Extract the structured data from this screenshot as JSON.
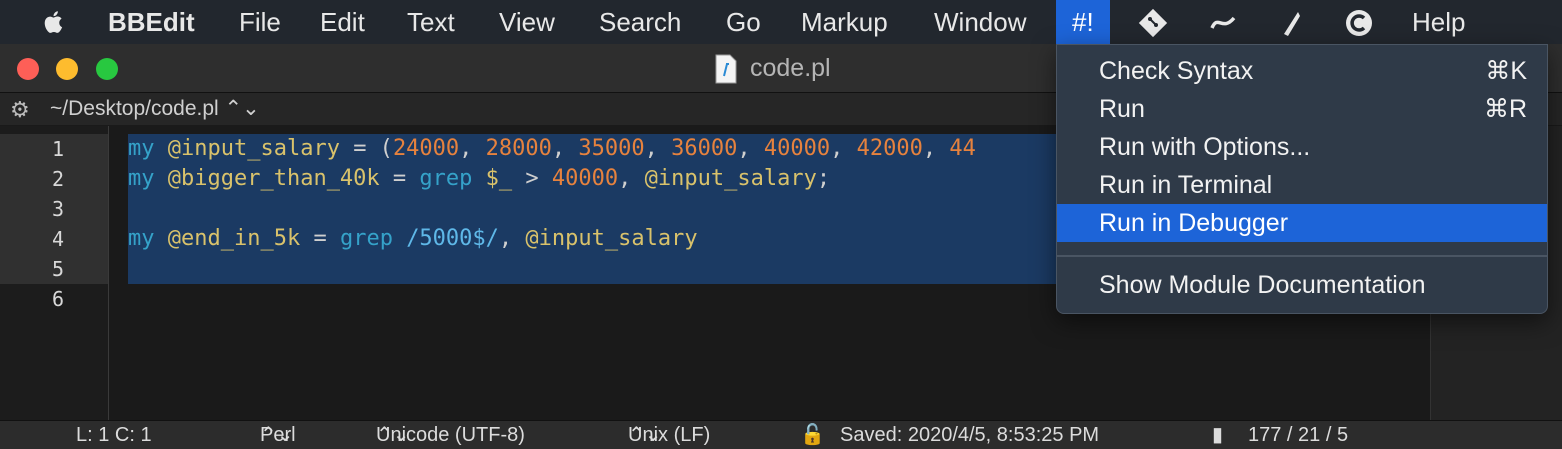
{
  "menubar": {
    "app": "BBEdit",
    "items": [
      "File",
      "Edit",
      "Text",
      "View",
      "Search",
      "Go",
      "Markup",
      "Window",
      "#!",
      "Help"
    ]
  },
  "window": {
    "title": "code.pl",
    "path": "~/Desktop/code.pl"
  },
  "editor": {
    "line_numbers": [
      "1",
      "2",
      "3",
      "4",
      "5",
      "6"
    ]
  },
  "menu": {
    "items": [
      {
        "label": "Check Syntax",
        "shortcut": "⌘K"
      },
      {
        "label": "Run",
        "shortcut": "⌘R"
      },
      {
        "label": "Run with Options...",
        "shortcut": ""
      },
      {
        "label": "Run in Terminal",
        "shortcut": ""
      },
      {
        "label": "Run in Debugger",
        "shortcut": ""
      },
      {
        "label": "Show Module Documentation",
        "shortcut": ""
      }
    ],
    "highlighted": "Run in Debugger"
  },
  "status": {
    "position": "L: 1 C: 1",
    "language": "Perl",
    "encoding": "Unicode (UTF-8)",
    "line_endings": "Unix (LF)",
    "saved": "Saved: 2020/4/5, 8:53:25 PM",
    "counts": "177 / 21 / 5"
  },
  "colors": {
    "accent": "#1d64d8",
    "keyword": "#35a2c9",
    "variable": "#d9c26b",
    "number": "#e6823e"
  }
}
